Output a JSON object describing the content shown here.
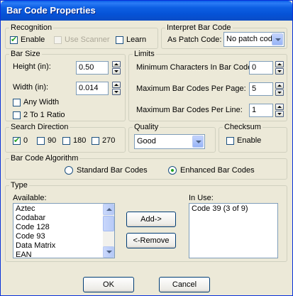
{
  "window": {
    "title": "Bar Code Properties"
  },
  "recognition": {
    "legend": "Recognition",
    "enable": {
      "label": "Enable",
      "checked": true
    },
    "use_scanner": {
      "label": "Use Scanner",
      "checked": false,
      "disabled": true
    },
    "learn": {
      "label": "Learn",
      "checked": false
    }
  },
  "interpret": {
    "legend": "Interpret Bar Code",
    "label": "As Patch Code:",
    "value": "No patch code"
  },
  "bar_size": {
    "legend": "Bar Size",
    "height_label": "Height (in):",
    "height_value": "0.50",
    "width_label": "Width (in):",
    "width_value": "0.014",
    "any_width": {
      "label": "Any Width",
      "checked": false
    },
    "two_to_one": {
      "label": "2 To 1 Ratio",
      "checked": false
    }
  },
  "limits": {
    "legend": "Limits",
    "min_chars_label": "Minimum Characters In Bar Code:",
    "min_chars_value": "0",
    "max_per_page_label": "Maximum Bar Codes Per Page:",
    "max_per_page_value": "5",
    "max_per_line_label": "Maximum Bar Codes Per Line:",
    "max_per_line_value": "1"
  },
  "search_direction": {
    "legend": "Search Direction",
    "d0": {
      "label": "0",
      "checked": true
    },
    "d90": {
      "label": "90",
      "checked": false
    },
    "d180": {
      "label": "180",
      "checked": false
    },
    "d270": {
      "label": "270",
      "checked": false
    }
  },
  "quality": {
    "legend": "Quality",
    "value": "Good"
  },
  "checksum": {
    "legend": "Checksum",
    "enable": {
      "label": "Enable",
      "checked": false
    }
  },
  "algorithm": {
    "legend": "Bar Code Algorithm",
    "standard": {
      "label": "Standard Bar Codes",
      "selected": false
    },
    "enhanced": {
      "label": "Enhanced Bar Codes",
      "selected": true
    }
  },
  "type": {
    "legend": "Type",
    "available_label": "Available:",
    "available": [
      "Aztec",
      "Codabar",
      "Code 128",
      "Code 93",
      "Data Matrix",
      "EAN"
    ],
    "in_use_label": "In Use:",
    "in_use": [
      "Code 39 (3 of 9)"
    ],
    "add_label": "Add->",
    "remove_label": "<-Remove"
  },
  "footer": {
    "ok_label": "OK",
    "cancel_label": "Cancel"
  },
  "colors": {
    "title_bar": "#0a5ee8",
    "check_mark": "#21a121",
    "dialog_bg": "#ece9d8"
  }
}
